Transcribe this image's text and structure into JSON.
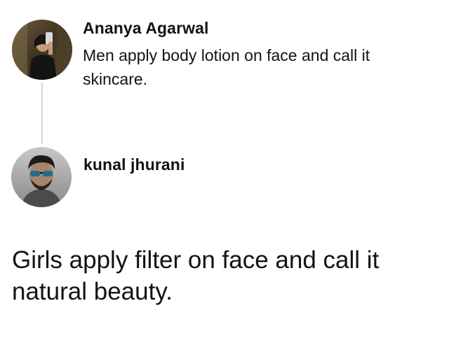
{
  "thread": {
    "original": {
      "author": "Ananya Agarwal",
      "text": "Men apply body lotion on face and call it skincare."
    },
    "reply": {
      "author": "kunal jhurani",
      "text": "Girls apply filter on face and call it natural beauty."
    }
  },
  "colors": {
    "background": "#ffffff",
    "text": "#0f1419",
    "thread_line": "#cfd9de"
  },
  "icons": {
    "original_avatar": "profile-photo",
    "reply_avatar": "profile-photo"
  }
}
